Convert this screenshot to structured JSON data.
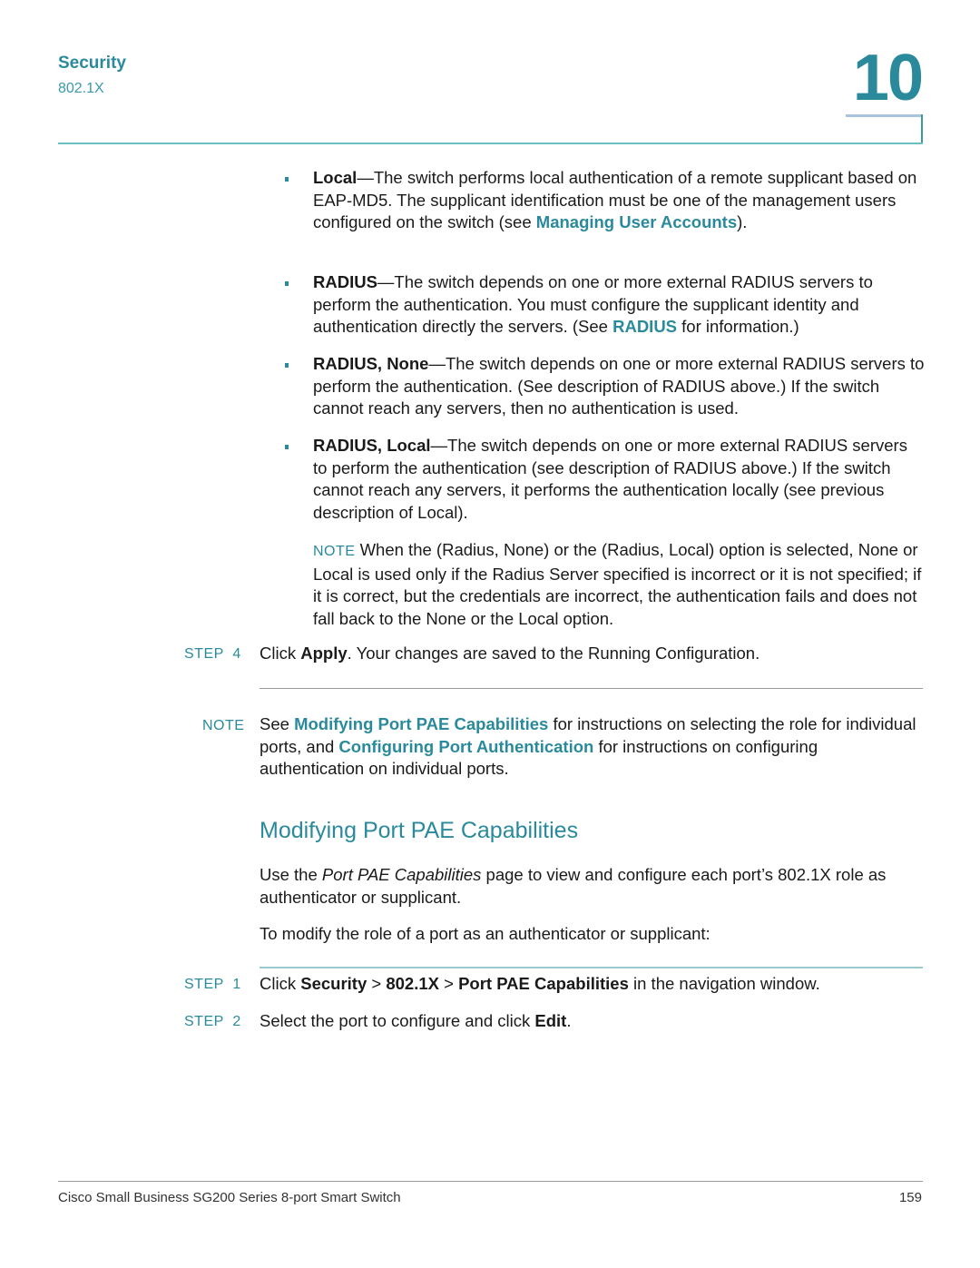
{
  "header": {
    "section": "Security",
    "subsection": "802.1X",
    "chapter_number": "10"
  },
  "bullets": [
    {
      "term": "Local",
      "text_before_link": "—The switch performs local authentication of a remote supplicant based on EAP-MD5. The supplicant identification must be one of the management users configured on the switch (see ",
      "link": "Managing User Accounts",
      "text_after_link": ")."
    },
    {
      "term": "RADIUS",
      "text_before_link": "—The switch depends on one or more external RADIUS servers to perform the authentication. You must configure the supplicant identity and authentication directly the servers. (See ",
      "link": "RADIUS",
      "text_after_link": " for information.)"
    },
    {
      "term": "RADIUS, None",
      "text": "—The switch depends on one or more external RADIUS servers to perform the authentication. (See description of RADIUS above.) If the switch cannot reach any servers, then no authentication is used."
    },
    {
      "term": "RADIUS, Local",
      "text": "—The switch depends on one or more external RADIUS servers to perform the authentication (see description of RADIUS above.) If the switch cannot reach any servers, it performs the authentication locally (see previous description of Local)."
    }
  ],
  "inner_note": {
    "label": "NOTE",
    "text": "When the (Radius, None) or the (Radius, Local) option is selected, None or Local is used only if the Radius Server specified is incorrect or it is not specified; if it is correct, but the credentials are incorrect, the authentication fails and does not fall back to the None or the Local option."
  },
  "step4": {
    "label": "STEP  4",
    "pre": "Click ",
    "bold": "Apply",
    "post": ". Your changes are saved to the Running Configuration."
  },
  "note2": {
    "label": "NOTE",
    "pre": "See ",
    "link1": "Modifying Port PAE Capabilities",
    "mid": " for instructions on selecting the role for individual ports, and ",
    "link2": "Configuring Port Authentication",
    "post": " for instructions on configuring authentication on individual ports."
  },
  "section": {
    "heading": "Modifying Port PAE Capabilities",
    "intro_pre": "Use the ",
    "intro_italic": "Port PAE Capabilities",
    "intro_post": " page to view and configure each port’s 802.1X role as authenticator or supplicant.",
    "lead": "To modify the role of a port as an authenticator or supplicant:"
  },
  "steps": [
    {
      "label": "STEP  1",
      "pre": "Click ",
      "b1": "Security",
      "sep1": " > ",
      "b2": "802.1X",
      "sep2": " > ",
      "b3": "Port PAE Capabilities",
      "post": " in the navigation window."
    },
    {
      "label": "STEP  2",
      "pre": "Select the port to configure and click ",
      "b1": "Edit",
      "post": "."
    }
  ],
  "footer": {
    "title": "Cisco Small Business SG200 Series 8-port Smart Switch",
    "page": "159"
  }
}
